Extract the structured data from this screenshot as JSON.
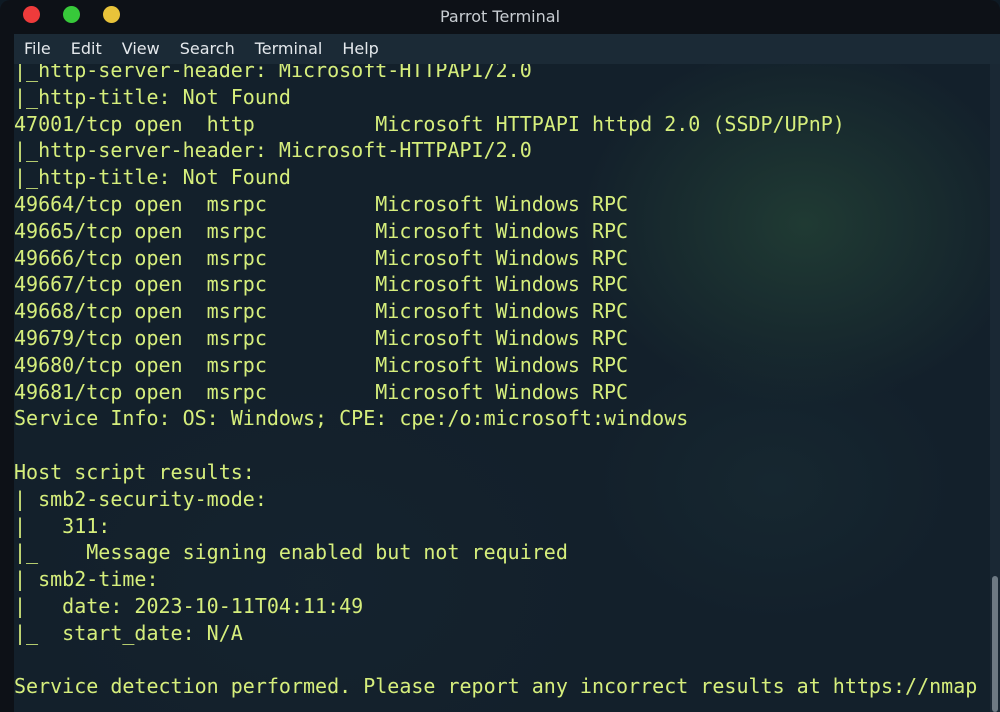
{
  "window": {
    "title": "Parrot Terminal",
    "controls": [
      "close",
      "maximize",
      "minimize"
    ]
  },
  "menubar": {
    "items": [
      "File",
      "Edit",
      "View",
      "Search",
      "Terminal",
      "Help"
    ]
  },
  "terminal": {
    "lines": [
      "|_http-server-header: Microsoft-HTTPAPI/2.0",
      "|_http-title: Not Found",
      "47001/tcp open  http          Microsoft HTTPAPI httpd 2.0 (SSDP/UPnP)",
      "|_http-server-header: Microsoft-HTTPAPI/2.0",
      "|_http-title: Not Found",
      "49664/tcp open  msrpc         Microsoft Windows RPC",
      "49665/tcp open  msrpc         Microsoft Windows RPC",
      "49666/tcp open  msrpc         Microsoft Windows RPC",
      "49667/tcp open  msrpc         Microsoft Windows RPC",
      "49668/tcp open  msrpc         Microsoft Windows RPC",
      "49679/tcp open  msrpc         Microsoft Windows RPC",
      "49680/tcp open  msrpc         Microsoft Windows RPC",
      "49681/tcp open  msrpc         Microsoft Windows RPC",
      "Service Info: OS: Windows; CPE: cpe:/o:microsoft:windows",
      "",
      "Host script results:",
      "| smb2-security-mode:",
      "|   311:",
      "|_    Message signing enabled but not required",
      "| smb2-time:",
      "|   date: 2023-10-11T04:11:49",
      "|_  start_date: N/A",
      "",
      "Service detection performed. Please report any incorrect results at https://nmap"
    ]
  },
  "colors": {
    "terminal_text": "#d6ee7c",
    "terminal_bg": "#13202b",
    "close": "#ee3b3b",
    "maximize": "#37c93a",
    "minimize": "#e8c33a"
  }
}
